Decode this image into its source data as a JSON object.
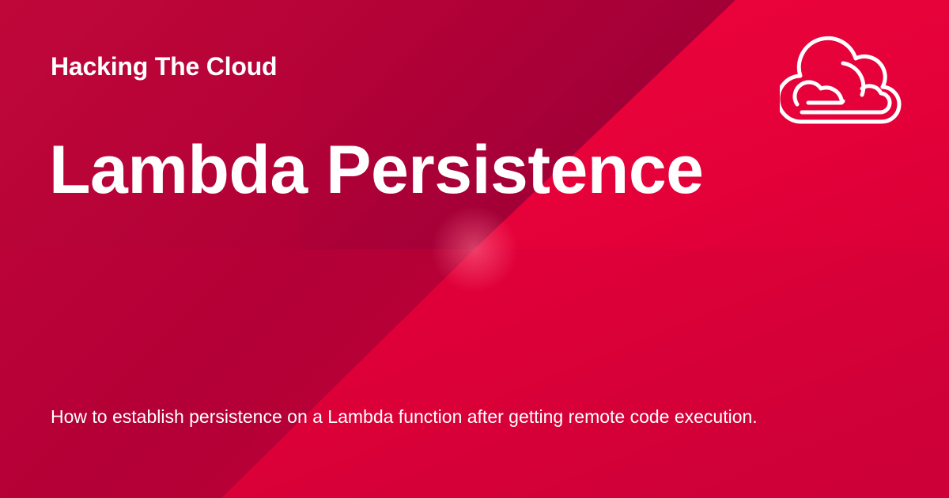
{
  "site": {
    "name": "Hacking The Cloud"
  },
  "page": {
    "title": "Lambda Persistence",
    "description": "How to establish persistence on a Lambda function after getting remote code execution."
  },
  "theme": {
    "primary": "#c0073a",
    "dark": "#9a0032",
    "bright": "#f0003a",
    "text": "#ffffff"
  },
  "icons": {
    "logo": "cloud-icon"
  }
}
